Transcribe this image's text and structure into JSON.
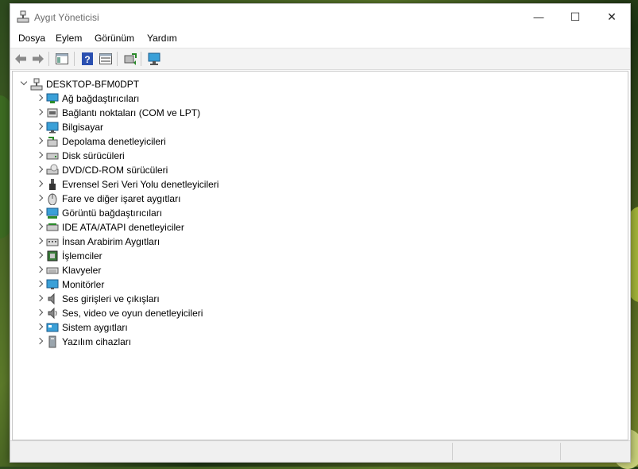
{
  "window": {
    "title": "Aygıt Yöneticisi",
    "controls": {
      "minimize": "—",
      "maximize": "☐",
      "close": "✕"
    }
  },
  "menu": [
    "Dosya",
    "Eylem",
    "Görünüm",
    "Yardım"
  ],
  "toolbar": {
    "buttons": [
      "back-icon",
      "forward-icon",
      "show-hide-tree-icon",
      "help-icon",
      "properties-view-icon",
      "update-driver-icon",
      "scan-hardware-icon"
    ]
  },
  "tree": {
    "root": "DESKTOP-BFM0DPT",
    "items": [
      {
        "label": "Ağ bağdaştırıcıları",
        "icon": "network-adapter-icon"
      },
      {
        "label": "Bağlantı noktaları (COM ve LPT)",
        "icon": "port-icon"
      },
      {
        "label": "Bilgisayar",
        "icon": "computer-icon"
      },
      {
        "label": "Depolama denetleyicileri",
        "icon": "storage-controller-icon"
      },
      {
        "label": "Disk sürücüleri",
        "icon": "disk-drive-icon"
      },
      {
        "label": "DVD/CD-ROM sürücüleri",
        "icon": "dvd-drive-icon"
      },
      {
        "label": "Evrensel Seri Veri Yolu denetleyicileri",
        "icon": "usb-icon"
      },
      {
        "label": "Fare ve diğer işaret aygıtları",
        "icon": "mouse-icon"
      },
      {
        "label": "Görüntü bağdaştırıcıları",
        "icon": "display-adapter-icon"
      },
      {
        "label": "IDE ATA/ATAPI denetleyiciler",
        "icon": "ide-controller-icon"
      },
      {
        "label": "İnsan Arabirim Aygıtları",
        "icon": "hid-icon"
      },
      {
        "label": "İşlemciler",
        "icon": "processor-icon"
      },
      {
        "label": "Klavyeler",
        "icon": "keyboard-icon"
      },
      {
        "label": "Monitörler",
        "icon": "monitor-icon"
      },
      {
        "label": "Ses girişleri ve çıkışları",
        "icon": "audio-io-icon"
      },
      {
        "label": "Ses, video ve oyun denetleyicileri",
        "icon": "sound-controller-icon"
      },
      {
        "label": "Sistem aygıtları",
        "icon": "system-devices-icon"
      },
      {
        "label": "Yazılım cihazları",
        "icon": "software-device-icon"
      }
    ]
  }
}
